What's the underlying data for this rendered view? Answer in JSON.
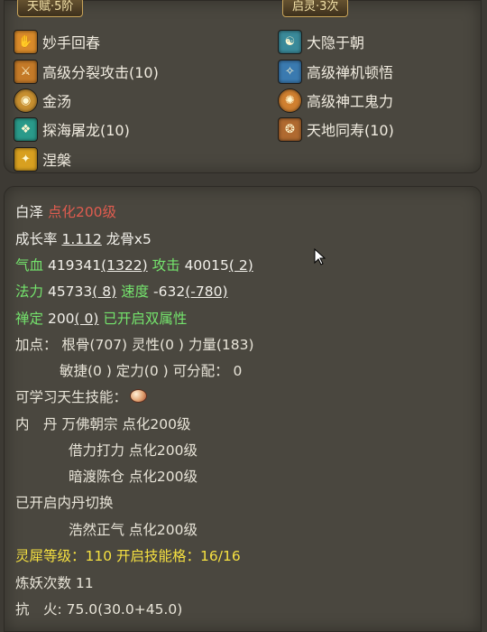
{
  "talent_tab": "天赋·5阶",
  "spirit_tab": "启灵·3次",
  "left_skills": [
    {
      "label": "妙手回春",
      "icon": "hand-heal-icon",
      "color": "#d98a2a"
    },
    {
      "label": "高级分裂攻击(10)",
      "icon": "split-attack-icon",
      "color": "#c47a28"
    },
    {
      "label": "金汤",
      "icon": "golden-shield-icon",
      "color": "#c89030"
    },
    {
      "label": "探海屠龙(10)",
      "icon": "sea-dragon-icon",
      "color": "#2a9a8a"
    },
    {
      "label": "涅槃",
      "icon": "phoenix-icon",
      "color": "#d8a020"
    }
  ],
  "right_skills": [
    {
      "label": "大隐于朝",
      "icon": "hidden-sage-icon",
      "color": "#3a8a9a"
    },
    {
      "label": "高级禅机顿悟",
      "icon": "zen-insight-icon",
      "color": "#3a7ab0"
    },
    {
      "label": "高级神工鬼力",
      "icon": "divine-craft-icon",
      "color": "#d08030"
    },
    {
      "label": "天地同寿(10)",
      "icon": "heaven-earth-icon",
      "color": "#b06a30"
    }
  ],
  "pet": {
    "name": "白泽",
    "tier": "点化200级",
    "growth_label": "成长率",
    "growth_value": "1.112",
    "bone": "龙骨x5",
    "hp_label": "气血",
    "hp_value": "419341",
    "hp_bonus": "(1322)",
    "atk_label": "攻击",
    "atk_value": "40015",
    "atk_bonus": "( 2)",
    "mp_label": "法力",
    "mp_value": "45733",
    "mp_bonus": "( 8)",
    "spd_label": "速度",
    "spd_value": "-632",
    "spd_bonus": "(-780)",
    "zen_label": "禅定",
    "zen_value": "200",
    "zen_bonus": "( 0)",
    "dual_attr": "已开启双属性",
    "points_line1": "加点： 根骨(707) 灵性(0 ) 力量(183)",
    "points_line2": "敏捷(0 ) 定力(0 ) 可分配： 0",
    "learnable": "可学习天生技能：",
    "neidan_label": "内　丹",
    "neidan1": "万佛朝宗 点化200级",
    "neidan2": "借力打力 点化200级",
    "neidan3": "暗渡陈仓 点化200级",
    "neidan_switch": "已开启内丹切换",
    "neidan4": "浩然正气 点化200级",
    "rhino_line": "灵犀等级：110 开启技能格：16/16",
    "demon_line": "炼妖次数 11",
    "resist_line": "抗　火: 75.0(30.0+45.0)"
  }
}
